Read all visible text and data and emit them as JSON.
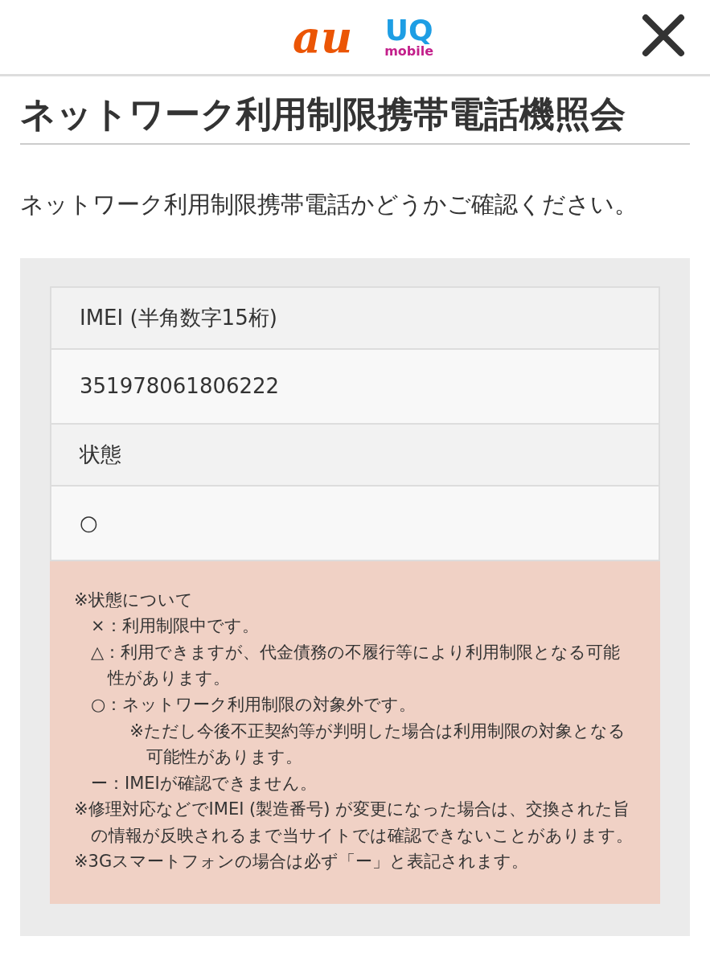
{
  "header": {
    "logos": [
      {
        "kind": "au",
        "text": "au"
      },
      {
        "kind": "uq",
        "text": "UQ",
        "subtext": "mobile"
      }
    ]
  },
  "title": "ネットワーク利用制限携帯電話機照会",
  "lead": "ネットワーク利用制限携帯電話かどうかご確認ください。",
  "result": {
    "rows": [
      {
        "label": "IMEI (半角数字15桁)",
        "value": "351978061806222"
      },
      {
        "label": "状態",
        "value": "○"
      }
    ]
  },
  "notes": [
    {
      "text": "※状態について",
      "children": [
        {
          "text": "×：利用制限中です。"
        },
        {
          "text": "△：利用できますが、代金債務の不履行等により利用制限となる可能性があります。"
        },
        {
          "text": "○：ネットワーク利用制限の対象外です。",
          "children": [
            {
              "text": "※ただし今後不正契約等が判明した場合は利用制限の対象となる可能性があります。"
            }
          ]
        },
        {
          "text": "ー：IMEIが確認できません。"
        }
      ]
    },
    {
      "text": "※修理対応などでIMEI (製造番号) が変更になった場合は、交換された旨の情報が反映されるまで当サイトでは確認できないことがあります。"
    },
    {
      "text": "※3Gスマートフォンの場合は必ず「ー」と表記されます。"
    }
  ]
}
